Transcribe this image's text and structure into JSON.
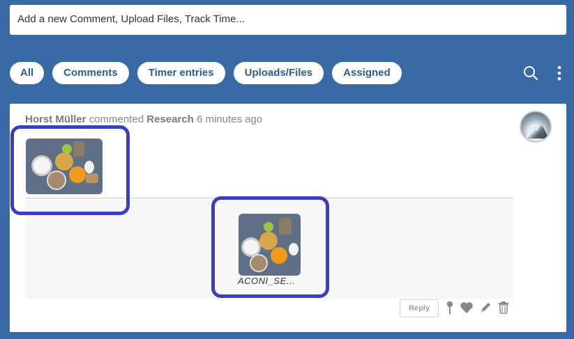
{
  "composer": {
    "placeholder": "Add a new Comment, Upload Files, Track Time..."
  },
  "filters": [
    {
      "label": "All"
    },
    {
      "label": "Comments"
    },
    {
      "label": "Timer entries"
    },
    {
      "label": "Uploads/Files"
    },
    {
      "label": "Assigned"
    }
  ],
  "toolbar": {
    "search_icon": "search-icon",
    "more_icon": "kebab-menu-icon"
  },
  "comment": {
    "author": "Horst Müller",
    "action": "commented",
    "target": "Research",
    "time": "6 minutes ago",
    "attachment": {
      "filename": "ACONI_SE..."
    },
    "reply_label": "Reply",
    "actions": [
      "pin-icon",
      "heart-icon",
      "edit-icon",
      "trash-icon"
    ]
  },
  "colors": {
    "background": "#3a6aa5",
    "pill_text": "#2e5c93",
    "highlight": "#3a3ec0"
  }
}
